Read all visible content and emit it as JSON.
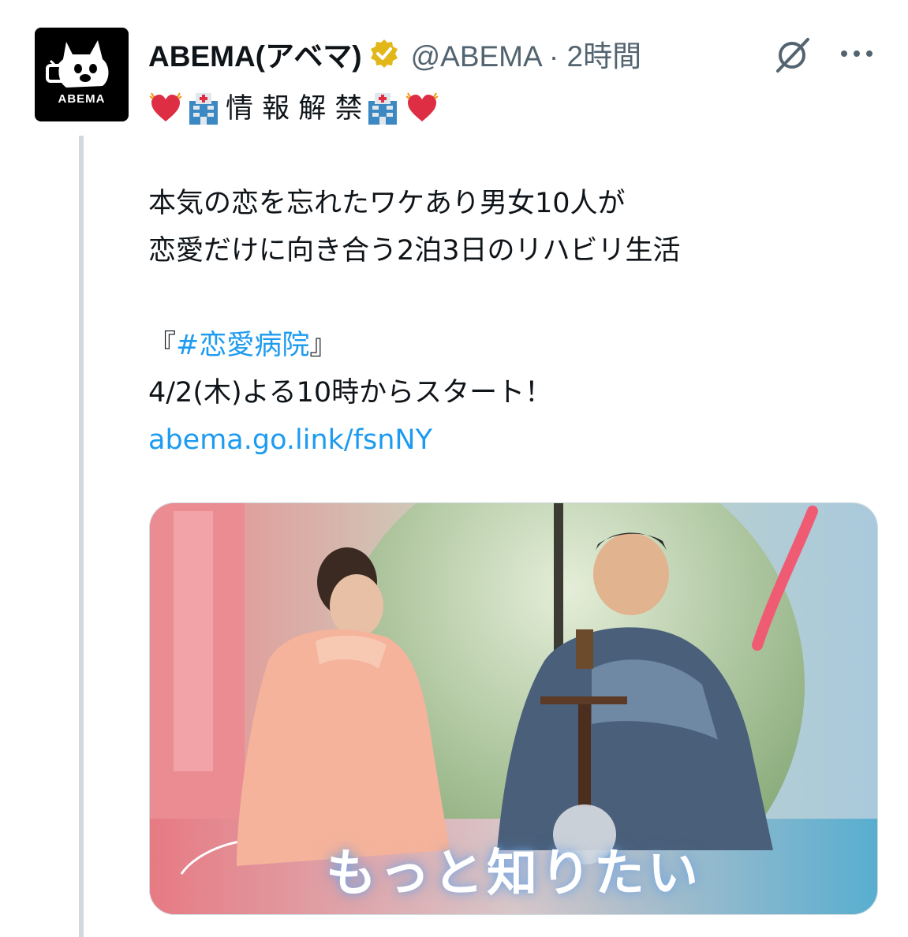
{
  "account": {
    "name": "ABEMA(アベマ)",
    "handle_time": "@ABEMA · 2時間",
    "avatar_text": "ABEMA"
  },
  "icons": {
    "verified": "verified-badge-icon",
    "grok": "grok-icon",
    "more": "more-icon"
  },
  "tweet": {
    "heading": "情 報 解 禁",
    "line1": "本気の恋を忘れたワケあり男女10人が",
    "line2": "恋愛だけに向き合う2泊3日のリハビリ生活",
    "title_open": "『",
    "hashtag": "#恋愛病院",
    "title_close": "』",
    "date_line": "4/2(木)よる10時からスタート！",
    "link": "abema.go.link/fsnNY"
  },
  "media": {
    "caption": "もっと知りたい"
  },
  "colors": {
    "link": "#1d9bf0",
    "verified": "#e2b719",
    "thread_line": "#cfd9de"
  }
}
